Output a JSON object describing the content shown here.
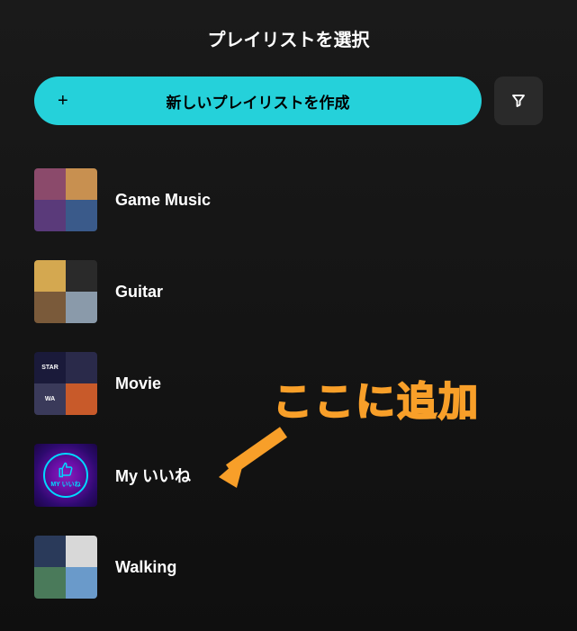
{
  "header": {
    "title": "プレイリストを選択"
  },
  "toolbar": {
    "create_label": "新しいプレイリストを作成"
  },
  "playlists": [
    {
      "name": "Game Music",
      "type": "grid"
    },
    {
      "name": "Guitar",
      "type": "grid"
    },
    {
      "name": "Movie",
      "type": "grid"
    },
    {
      "name": "My いいね",
      "type": "like"
    },
    {
      "name": "Walking",
      "type": "grid"
    }
  ],
  "annotation": {
    "text": "ここに追加"
  },
  "cover_colors": {
    "game_music": [
      "#8b4a6b",
      "#c89050",
      "#5a3a7a",
      "#3a5a8a"
    ],
    "guitar": [
      "#d4a850",
      "#2a2a2a",
      "#7a5a3a",
      "#8a9aaa"
    ],
    "movie": [
      "#1a1a3a",
      "#2a2a4a",
      "#3a3a5a",
      "#c85a2a"
    ],
    "walking": [
      "#2a3a5a",
      "#d8d8d8",
      "#4a7a5a",
      "#6a9aca"
    ]
  },
  "like_cover_text": "MY いいね"
}
